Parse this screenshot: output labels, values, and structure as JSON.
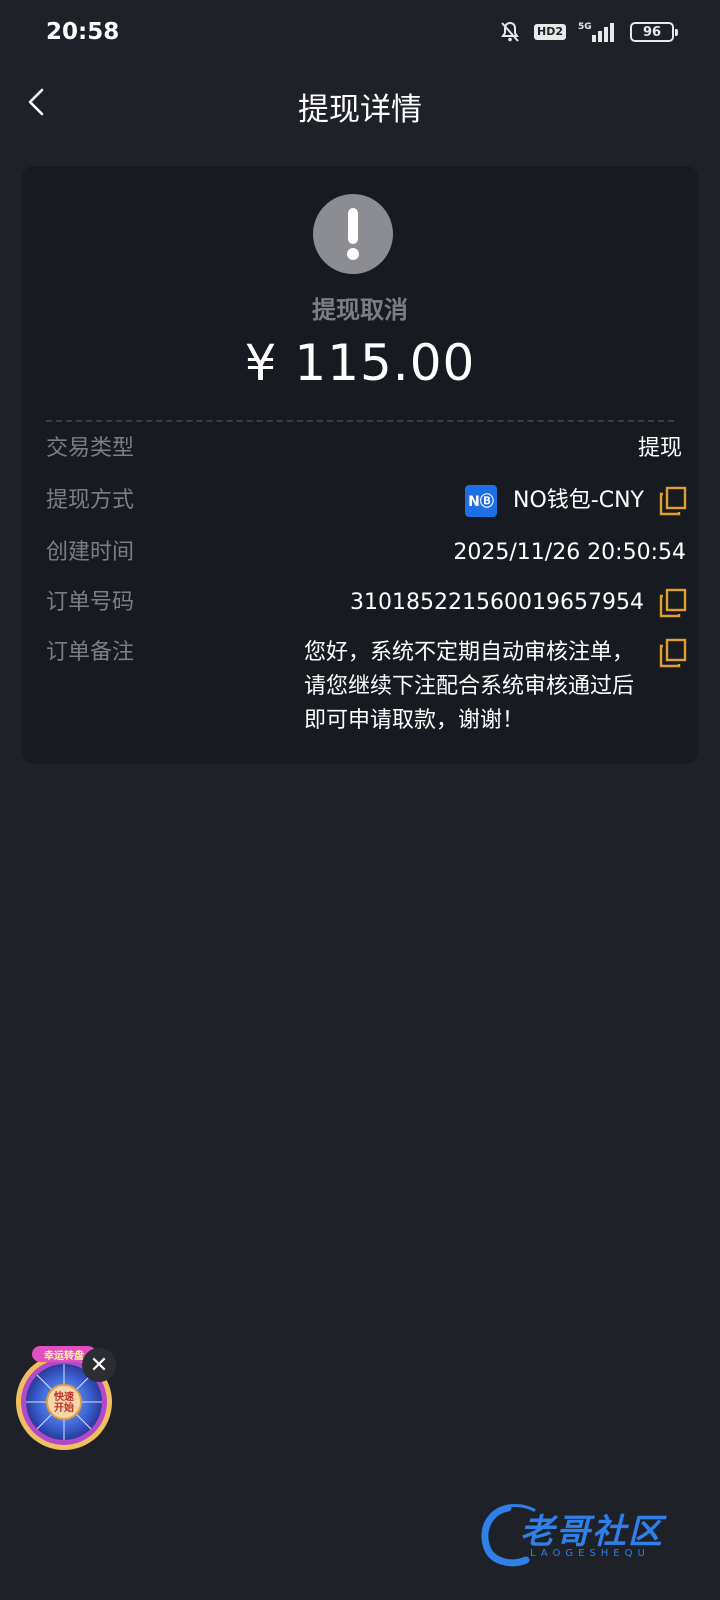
{
  "status_bar": {
    "time": "20:58",
    "hd_label": "HD2",
    "network": "5G",
    "battery": "96"
  },
  "nav": {
    "title": "提现详情",
    "back_icon": "chevron-left-icon"
  },
  "summary": {
    "status_icon": "exclamation-icon",
    "status_text": "提现取消",
    "amount": "¥ 115.00",
    "status_color": "#8b8d93"
  },
  "details": {
    "type_label": "交易类型",
    "type_value": "提现",
    "method_label": "提现方式",
    "method_logo": "NⒷ",
    "method_value": "NO钱包-CNY",
    "created_label": "创建时间",
    "created_value": "2025/11/26 20:50:54",
    "order_label": "订单号码",
    "order_value": "310185221560019657954",
    "remark_label": "订单备注",
    "remark_value": "您好，系统不定期自动审核注单，请您继续下注配合系统审核通过后即可申请取款，谢谢！"
  },
  "floating_widget": {
    "badge_text": "幸运转盘",
    "center_text": "快速开始",
    "close_label": "✕"
  },
  "watermark": {
    "title": "老哥社区",
    "subtitle": "LAOGESHEQU"
  },
  "colors": {
    "background": "#1f2129",
    "card": "#171a20",
    "accent_copy": "#e0a030",
    "wallet_blue": "#1e6fe6"
  }
}
